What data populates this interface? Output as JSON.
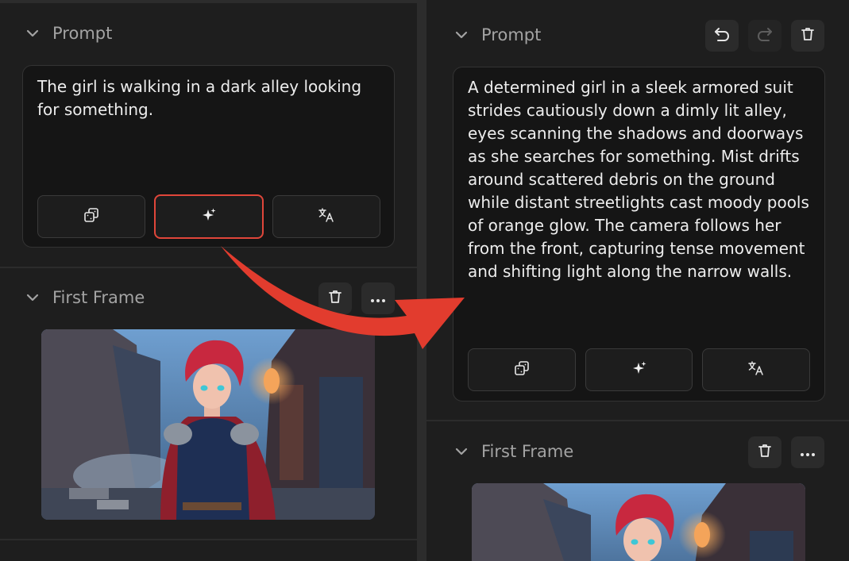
{
  "left": {
    "prompt_section": {
      "title": "Prompt",
      "text": "The girl is walking in a dark alley looking for something."
    },
    "tools": [
      {
        "icon": "dice-icon"
      },
      {
        "icon": "sparkle-icon"
      },
      {
        "icon": "translate-icon"
      }
    ],
    "frame_section": {
      "title": "First Frame"
    }
  },
  "right": {
    "prompt_section": {
      "title": "Prompt",
      "text": "A determined girl in a sleek armored suit strides cautiously down a dimly lit alley, eyes scanning the shadows and doorways as she searches for something. Mist drifts around scattered debris on the ground while distant streetlights cast moody pools of orange glow. The camera follows her from the front, capturing tense movement and shifting light along the narrow walls."
    },
    "header_actions": [
      {
        "icon": "undo-icon"
      },
      {
        "icon": "redo-icon"
      },
      {
        "icon": "trash-icon"
      }
    ],
    "tools": [
      {
        "icon": "dice-icon"
      },
      {
        "icon": "sparkle-icon"
      },
      {
        "icon": "translate-icon"
      }
    ],
    "frame_section": {
      "title": "First Frame"
    },
    "frame_actions": [
      {
        "icon": "trash-icon"
      },
      {
        "icon": "more-icon"
      }
    ]
  },
  "colors": {
    "highlight": "#e0463a",
    "arrow": "#e23c2e",
    "background": "#1e1e1e"
  }
}
